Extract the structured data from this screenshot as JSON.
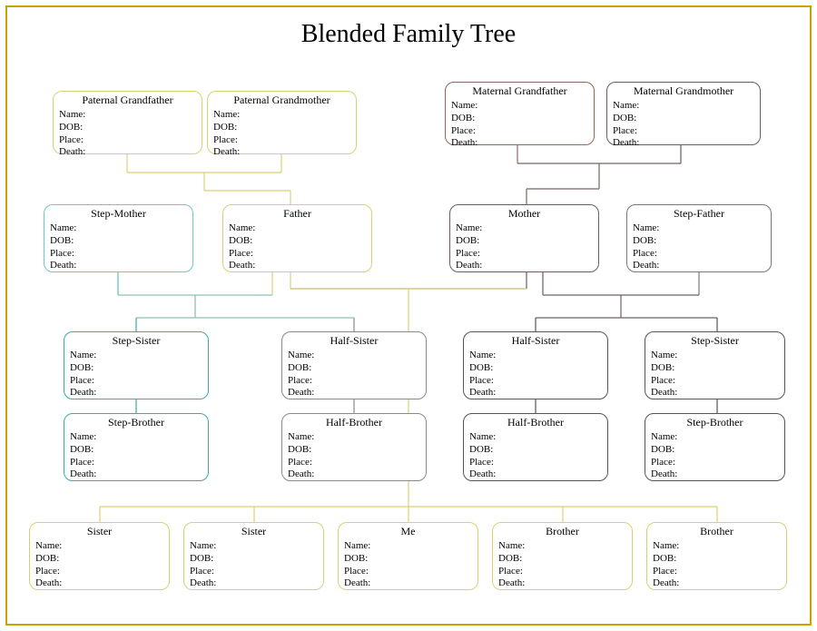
{
  "title": "Blended Family Tree",
  "field_labels": {
    "name": "Name:",
    "dob": "DOB:",
    "place": "Place:",
    "death": "Death:"
  },
  "colors": {
    "frame": "#c9a400",
    "pat_gp": "#d9d178",
    "mat_gf": "#8a6a5a",
    "mat_gm": "#6a5a6a",
    "step_mother": "#6fc7c7",
    "father": "#d9d178",
    "mother": "#6a5a6a",
    "step_father": "#777",
    "step_left_children": "#3aa9a9",
    "half_left_children": "#888",
    "half_right_children": "#555",
    "step_right_children": "#555",
    "bottom_children": "#d9d178"
  },
  "cards": {
    "pat_gf": {
      "role": "Paternal Grandfather"
    },
    "pat_gm": {
      "role": "Paternal Grandmother"
    },
    "mat_gf": {
      "role": "Maternal Grandfather"
    },
    "mat_gm": {
      "role": "Maternal Grandmother"
    },
    "step_mother": {
      "role": "Step-Mother"
    },
    "father": {
      "role": "Father"
    },
    "mother": {
      "role": "Mother"
    },
    "step_father": {
      "role": "Step-Father"
    },
    "ss_l": {
      "role": "Step-Sister"
    },
    "hs_l": {
      "role": "Half-Sister"
    },
    "sb_l": {
      "role": "Step-Brother"
    },
    "hb_l": {
      "role": "Half-Brother"
    },
    "hs_r": {
      "role": "Half-Sister"
    },
    "ss_r": {
      "role": "Step-Sister"
    },
    "hb_r": {
      "role": "Half-Brother"
    },
    "sb_r": {
      "role": "Step-Brother"
    },
    "sister1": {
      "role": "Sister"
    },
    "sister2": {
      "role": "Sister"
    },
    "me": {
      "role": "Me"
    },
    "brother1": {
      "role": "Brother"
    },
    "brother2": {
      "role": "Brother"
    }
  },
  "watermark": ""
}
